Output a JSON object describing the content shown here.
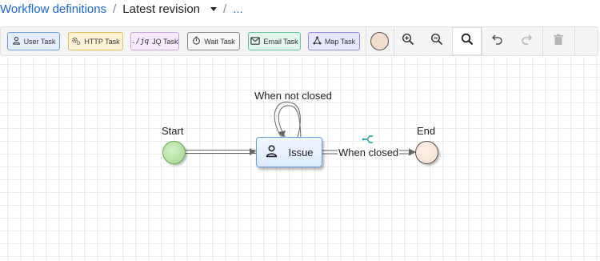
{
  "breadcrumb": {
    "root": "Workflow definitions",
    "current": "Latest revision",
    "more": "..."
  },
  "toolbar": {
    "tasks": [
      {
        "label": "User Task",
        "icon": "user-icon",
        "bg": "#e4eeff",
        "border": "#6f9ee6"
      },
      {
        "label": "HTTP Task",
        "icon": "gears-icon",
        "bg": "#fff4d6",
        "border": "#e0bd5c"
      },
      {
        "label": "JQ Task",
        "icon": "jq-icon",
        "icon_text": "./jq",
        "bg": "#f6eafc",
        "border": "#c7a3e0"
      },
      {
        "label": "Wait Task",
        "icon": "stopwatch-icon",
        "bg": "#f7f7f7",
        "border": "#8a8a8a"
      },
      {
        "label": "Email Task",
        "icon": "mail-icon",
        "bg": "#e3f7ee",
        "border": "#5ec49a"
      },
      {
        "label": "Map Task",
        "icon": "map-nodes-icon",
        "bg": "#e6e8ff",
        "border": "#8e8fe0"
      }
    ],
    "tools": [
      "zoom-in-icon",
      "zoom-out-icon",
      "zoom-fit-icon",
      "undo-icon",
      "redo-icon",
      "trash-icon"
    ]
  },
  "canvas": {
    "start_label": "Start",
    "end_label": "End",
    "task_label": "Issue",
    "task_icon": "user-icon",
    "self_loop_label": "When not closed",
    "edge_label": "When closed",
    "condition_icon": "branch-icon"
  },
  "colors": {
    "link": "#1a66d6",
    "start": "#9fd68a",
    "task_border": "#6a9fe0",
    "branch_icon": "#1aa39a"
  }
}
